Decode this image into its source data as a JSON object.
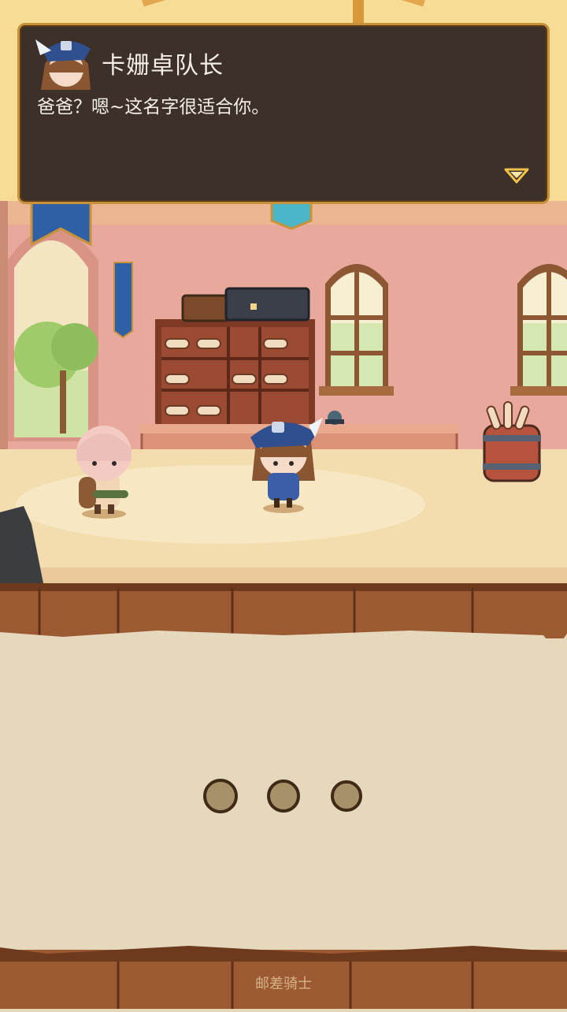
{
  "dialog": {
    "speaker": "卡姗卓队长",
    "line": "爸爸？嗯~这名字很适合你。"
  },
  "choice_dots": [
    {
      "name": "option-dot-1"
    },
    {
      "name": "option-dot-2"
    },
    {
      "name": "option-dot-3"
    }
  ],
  "footer": {
    "title": "邮差骑士"
  },
  "colors": {
    "dialog_bg": "#3c3029",
    "dialog_border": "#c8923b",
    "parchment": "#e7d7b9",
    "wood": "#8a4f2a"
  }
}
